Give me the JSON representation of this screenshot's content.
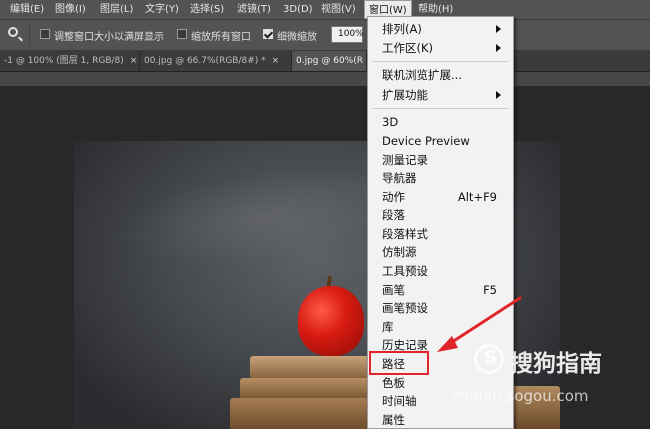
{
  "menubar": {
    "items": [
      "编辑(E)",
      "图像(I)",
      "图层(L)",
      "文字(Y)",
      "选择(S)",
      "滤镜(T)",
      "3D(D)",
      "视图(V)",
      "窗口(W)",
      "帮助(H)"
    ]
  },
  "options": {
    "fit_windows": "调整窗口大小以满屏显示",
    "zoom_all": "缩放所有窗口",
    "scrubby_zoom": "细微缩放",
    "zoom_value": "100%"
  },
  "tabs": [
    {
      "label": "-1 @ 100% (图层 1, RGB/8)",
      "close": "×"
    },
    {
      "label": "00.jpg @ 66.7%(RGB/8#) *",
      "close": "×"
    },
    {
      "label": "0.jpg @ 60%(R"
    }
  ],
  "window_menu": {
    "items": [
      {
        "label": "排列(A)",
        "submenu": true
      },
      {
        "label": "工作区(K)",
        "submenu": true
      },
      {
        "label": "联机浏览扩展..."
      },
      {
        "label": "扩展功能",
        "submenu": true
      },
      {
        "label": "3D"
      },
      {
        "label": "Device Preview"
      },
      {
        "label": "测量记录"
      },
      {
        "label": "导航器"
      },
      {
        "label": "动作",
        "shortcut": "Alt+F9"
      },
      {
        "label": "段落"
      },
      {
        "label": "段落样式"
      },
      {
        "label": "仿制源"
      },
      {
        "label": "工具预设"
      },
      {
        "label": "画笔",
        "shortcut": "F5"
      },
      {
        "label": "画笔预设"
      },
      {
        "label": "库"
      },
      {
        "label": "历史记录"
      },
      {
        "label": "路径"
      },
      {
        "label": "色板"
      },
      {
        "label": "时间轴"
      },
      {
        "label": "属性"
      }
    ]
  },
  "watermark": {
    "brand": "搜狗指南",
    "domain": "zhinan.sogou.com"
  },
  "colors": {
    "annotation_red": "#e0252a",
    "menu_bg": "#f2f2f2",
    "app_chrome": "#535353"
  }
}
